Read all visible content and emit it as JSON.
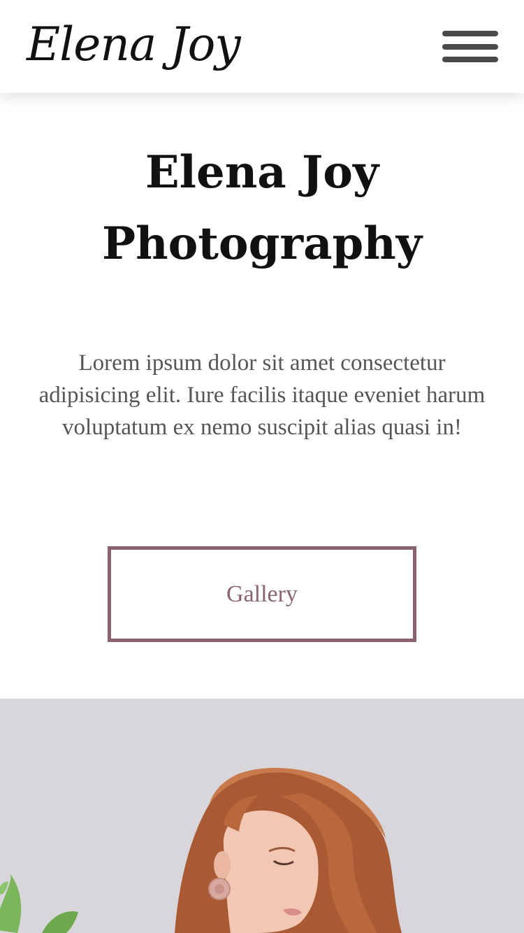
{
  "header": {
    "logo_text": "Elena Joy",
    "menu_icon": "hamburger-menu-icon"
  },
  "hero": {
    "title_line1": "Elena Joy",
    "title_line2": "Photography",
    "description": "Lorem ipsum dolor sit amet consectetur adipisicing elit. Iure facilis itaque eveniet harum voluptatum ex nemo suscipit alias quasi in!",
    "gallery_label": "Gallery"
  },
  "colors": {
    "accent": "#8a6372",
    "photo_background": "#d9d6db",
    "text_muted": "#555555",
    "hair": "#b8643a"
  }
}
